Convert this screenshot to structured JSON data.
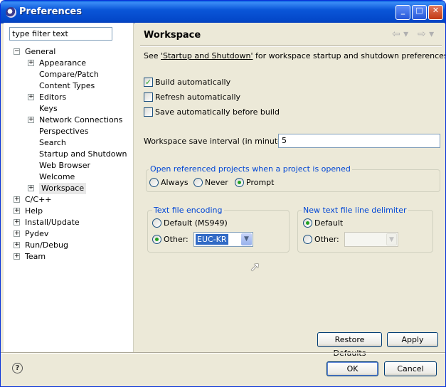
{
  "window": {
    "title": "Preferences",
    "controls": {
      "minimize": "_",
      "maximize": "□",
      "close": "✕"
    }
  },
  "filter": {
    "value": "type filter text"
  },
  "tree": [
    {
      "label": "General",
      "expanded": true,
      "level": 0
    },
    {
      "label": "Appearance",
      "expandable": true,
      "level": 1
    },
    {
      "label": "Compare/Patch",
      "level": 1
    },
    {
      "label": "Content Types",
      "level": 1
    },
    {
      "label": "Editors",
      "expandable": true,
      "level": 1
    },
    {
      "label": "Keys",
      "level": 1
    },
    {
      "label": "Network Connections",
      "expandable": true,
      "level": 1
    },
    {
      "label": "Perspectives",
      "level": 1
    },
    {
      "label": "Search",
      "level": 1
    },
    {
      "label": "Startup and Shutdown",
      "level": 1
    },
    {
      "label": "Web Browser",
      "level": 1
    },
    {
      "label": "Welcome",
      "level": 1
    },
    {
      "label": "Workspace",
      "expandable": true,
      "level": 1,
      "selected": true
    },
    {
      "label": "C/C++",
      "expandable": true,
      "level": 0
    },
    {
      "label": "Help",
      "expandable": true,
      "level": 0
    },
    {
      "label": "Install/Update",
      "expandable": true,
      "level": 0
    },
    {
      "label": "Pydev",
      "expandable": true,
      "level": 0
    },
    {
      "label": "Run/Debug",
      "expandable": true,
      "level": 0
    },
    {
      "label": "Team",
      "expandable": true,
      "level": 0
    }
  ],
  "page": {
    "title": "Workspace",
    "intro_prefix": "See ",
    "intro_link": "'Startup and Shutdown'",
    "intro_suffix": " for workspace startup and shutdown preferences.",
    "build_automatically": {
      "label": "Build automatically",
      "checked": true
    },
    "refresh_automatically": {
      "label": "Refresh automatically",
      "checked": false
    },
    "save_before_build": {
      "label": "Save automatically before build",
      "checked": false
    },
    "save_interval": {
      "label": "Workspace save interval (in minutes):",
      "value": "5"
    },
    "open_referenced": {
      "title": "Open referenced projects when a project is opened",
      "options": [
        "Always",
        "Never",
        "Prompt"
      ],
      "selected": "Prompt"
    },
    "encoding": {
      "title": "Text file encoding",
      "default_label": "Default (MS949)",
      "other_label": "Other:",
      "selected": "Other",
      "other_value": "EUC-KR"
    },
    "line_delimiter": {
      "title": "New text file line delimiter",
      "default_label": "Default",
      "other_label": "Other:",
      "selected": "Default",
      "other_value": ""
    },
    "restore_defaults": "Restore Defaults",
    "apply": "Apply"
  },
  "footer": {
    "ok": "OK",
    "cancel": "Cancel",
    "help_icon": "?"
  },
  "colors": {
    "titlebar": "#0a56d8",
    "dialog_bg": "#ece9d8",
    "group_title": "#0046d5",
    "check": "#21a121"
  }
}
